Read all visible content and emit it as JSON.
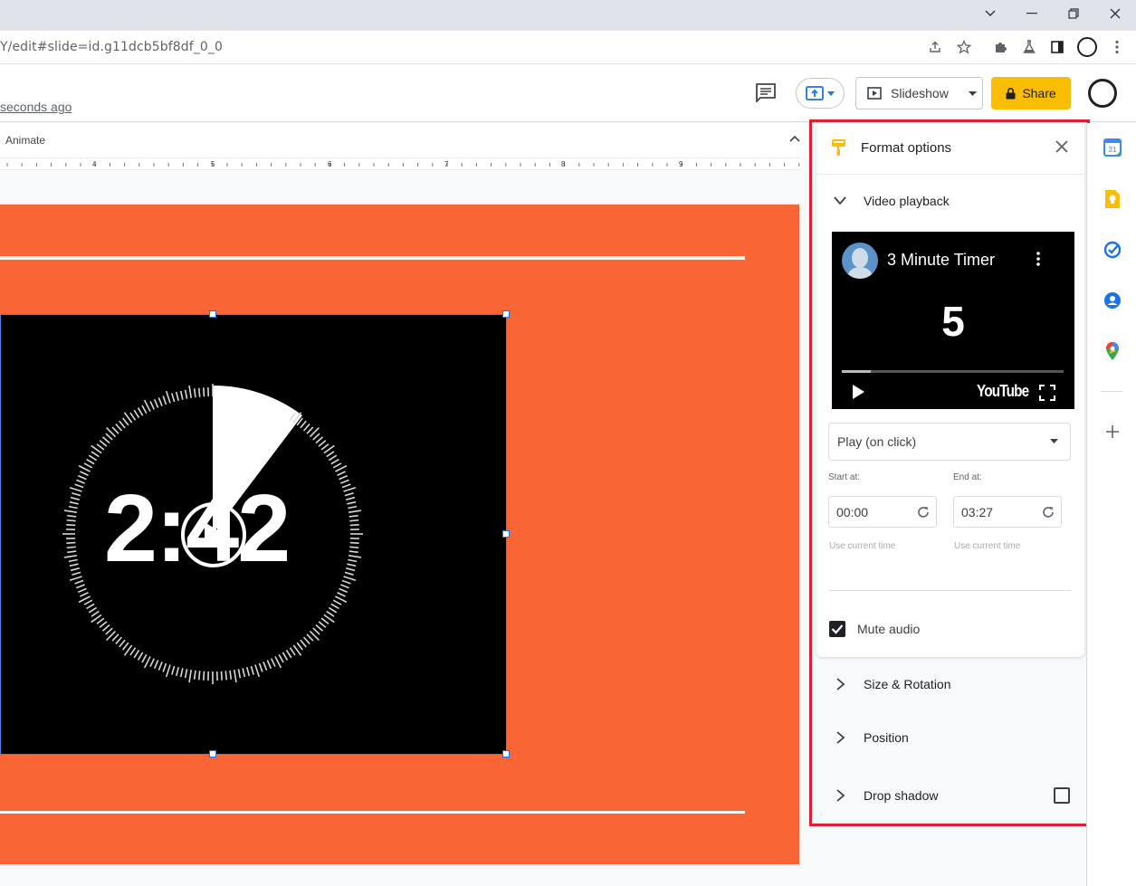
{
  "browser": {
    "url": "Y/edit#slide=id.g11dcb5bf8df_0_0"
  },
  "header": {
    "saved_status": "seconds ago",
    "slideshow_label": "Slideshow",
    "share_label": "Share"
  },
  "toolbar": {
    "animate_label": "Animate"
  },
  "ruler": {
    "numbers": [
      "4",
      "5",
      "6",
      "7",
      "8",
      "9"
    ]
  },
  "slide": {
    "timer_text": "2:42",
    "background_color": "#f96534"
  },
  "format_panel": {
    "title": "Format options",
    "video_playback": {
      "section_label": "Video playback",
      "video_title": "3 Minute Timer",
      "countdown": "5",
      "platform": "YouTube",
      "progress": 0.13,
      "play_mode": "Play (on click)",
      "start_label": "Start at:",
      "start_value": "00:00",
      "end_label": "End at:",
      "end_value": "03:27",
      "use_current_time": "Use current time",
      "mute_label": "Mute audio",
      "mute_checked": true
    },
    "sections": [
      {
        "label": "Size & Rotation"
      },
      {
        "label": "Position"
      },
      {
        "label": "Drop shadow",
        "checked": false
      }
    ]
  },
  "colors": {
    "accent": "#1a73e8",
    "share": "#fbbc04",
    "highlight": "#e0202e"
  },
  "side_icons": [
    "calendar-icon",
    "keep-icon",
    "tasks-icon",
    "contacts-icon",
    "maps-icon",
    "plus-icon"
  ]
}
